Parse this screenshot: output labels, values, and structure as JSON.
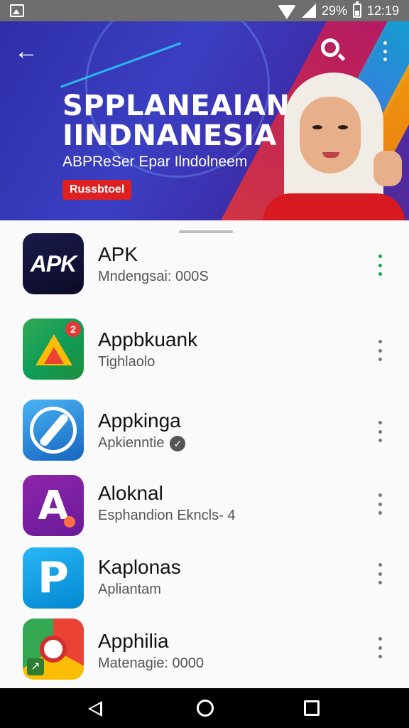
{
  "status_bar": {
    "battery": "29%",
    "time": "12:19"
  },
  "banner": {
    "title_line1": "SPPLANEAIAN",
    "title_line2": "IINDNANESIA",
    "subtitle": "ABPReSer Epar Ilndolneem",
    "badge": "Russbtoel"
  },
  "apps": [
    {
      "name": "APK",
      "subtitle": "Mndengsai: 000S",
      "icon": "apk-icon"
    },
    {
      "name": "Appbkuank",
      "subtitle": "Tighlaolo",
      "icon": "drive-icon",
      "badge": "2"
    },
    {
      "name": "Appkinga",
      "subtitle": "Apkienntie",
      "icon": "compass-icon"
    },
    {
      "name": "Aloknal",
      "subtitle": "Esphandion Ekncls- 4",
      "icon": "letter-a-icon"
    },
    {
      "name": "Kaplonas",
      "subtitle": "Apliantam",
      "icon": "letter-p-icon"
    },
    {
      "name": "Apphilia",
      "subtitle": "Matenagie: 0000",
      "icon": "chrome-icon"
    }
  ],
  "colors": {
    "accent_green": "#1aa34a",
    "banner_bg": "#3b3fc2",
    "badge_red": "#e02020"
  }
}
